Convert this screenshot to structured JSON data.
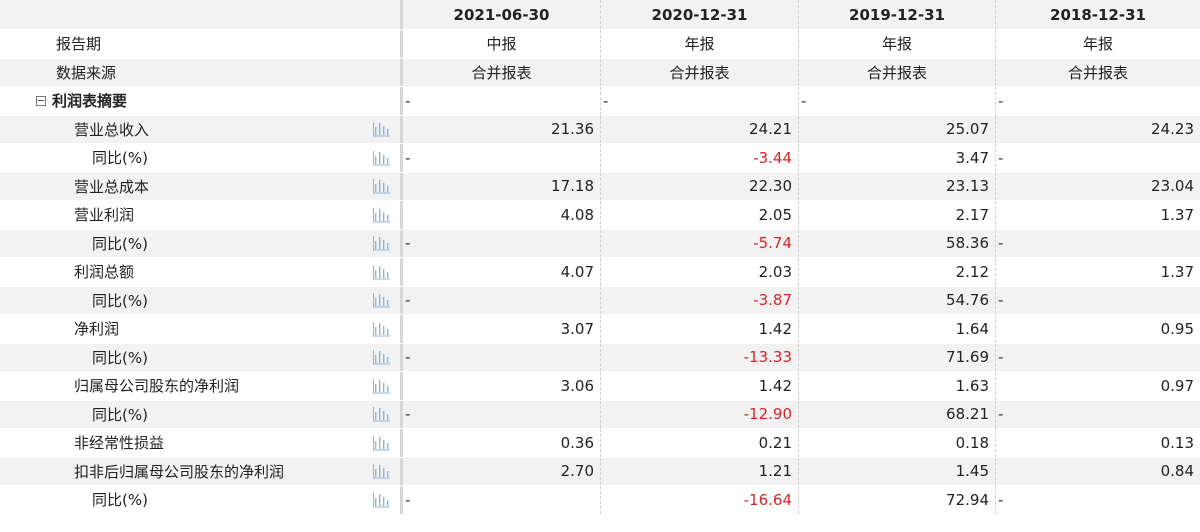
{
  "columns": [
    "2021-06-30",
    "2020-12-31",
    "2019-12-31",
    "2018-12-31"
  ],
  "header_rows": [
    {
      "label": "报告期",
      "values": [
        "中报",
        "年报",
        "年报",
        "年报"
      ]
    },
    {
      "label": "数据来源",
      "values": [
        "合并报表",
        "合并报表",
        "合并报表",
        "合并报表"
      ]
    }
  ],
  "section": {
    "label": "利润表摘要",
    "values": [
      "-",
      "-",
      "-",
      "-"
    ]
  },
  "rows": [
    {
      "label": "营业总收入",
      "level": 1,
      "values": [
        "21.36",
        "24.21",
        "25.07",
        "24.23"
      ]
    },
    {
      "label": "同比(%)",
      "level": 2,
      "values": [
        "-",
        "-3.44",
        "3.47",
        "-"
      ]
    },
    {
      "label": "营业总成本",
      "level": 1,
      "values": [
        "17.18",
        "22.30",
        "23.13",
        "23.04"
      ]
    },
    {
      "label": "营业利润",
      "level": 1,
      "values": [
        "4.08",
        "2.05",
        "2.17",
        "1.37"
      ]
    },
    {
      "label": "同比(%)",
      "level": 2,
      "values": [
        "-",
        "-5.74",
        "58.36",
        "-"
      ]
    },
    {
      "label": "利润总额",
      "level": 1,
      "values": [
        "4.07",
        "2.03",
        "2.12",
        "1.37"
      ]
    },
    {
      "label": "同比(%)",
      "level": 2,
      "values": [
        "-",
        "-3.87",
        "54.76",
        "-"
      ]
    },
    {
      "label": "净利润",
      "level": 1,
      "values": [
        "3.07",
        "1.42",
        "1.64",
        "0.95"
      ]
    },
    {
      "label": "同比(%)",
      "level": 2,
      "values": [
        "-",
        "-13.33",
        "71.69",
        "-"
      ]
    },
    {
      "label": "归属母公司股东的净利润",
      "level": 1,
      "values": [
        "3.06",
        "1.42",
        "1.63",
        "0.97"
      ]
    },
    {
      "label": "同比(%)",
      "level": 2,
      "values": [
        "-",
        "-12.90",
        "68.21",
        "-"
      ]
    },
    {
      "label": "非经常性损益",
      "level": 1,
      "values": [
        "0.36",
        "0.21",
        "0.18",
        "0.13"
      ]
    },
    {
      "label": "扣非后归属母公司股东的净利润",
      "level": 1,
      "values": [
        "2.70",
        "1.21",
        "1.45",
        "0.84"
      ]
    },
    {
      "label": "同比(%)",
      "level": 2,
      "values": [
        "-",
        "-16.64",
        "72.94",
        "-"
      ]
    }
  ],
  "icons": {
    "chart": "bar-chart-icon",
    "collapse": "collapse-icon"
  },
  "colors": {
    "negative": "#d1262b",
    "stripe": "#f2f2f2",
    "icon": "#8fb3d9"
  }
}
